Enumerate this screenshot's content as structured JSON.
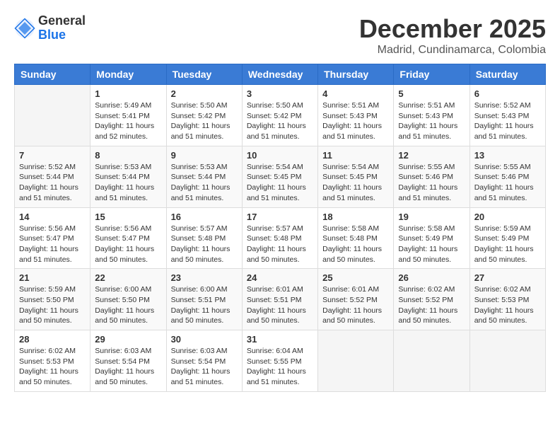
{
  "logo": {
    "general": "General",
    "blue": "Blue"
  },
  "title": "December 2025",
  "subtitle": "Madrid, Cundinamarca, Colombia",
  "weekdays": [
    "Sunday",
    "Monday",
    "Tuesday",
    "Wednesday",
    "Thursday",
    "Friday",
    "Saturday"
  ],
  "weeks": [
    [
      {
        "day": "",
        "info": ""
      },
      {
        "day": "1",
        "info": "Sunrise: 5:49 AM\nSunset: 5:41 PM\nDaylight: 11 hours\nand 52 minutes."
      },
      {
        "day": "2",
        "info": "Sunrise: 5:50 AM\nSunset: 5:42 PM\nDaylight: 11 hours\nand 51 minutes."
      },
      {
        "day": "3",
        "info": "Sunrise: 5:50 AM\nSunset: 5:42 PM\nDaylight: 11 hours\nand 51 minutes."
      },
      {
        "day": "4",
        "info": "Sunrise: 5:51 AM\nSunset: 5:43 PM\nDaylight: 11 hours\nand 51 minutes."
      },
      {
        "day": "5",
        "info": "Sunrise: 5:51 AM\nSunset: 5:43 PM\nDaylight: 11 hours\nand 51 minutes."
      },
      {
        "day": "6",
        "info": "Sunrise: 5:52 AM\nSunset: 5:43 PM\nDaylight: 11 hours\nand 51 minutes."
      }
    ],
    [
      {
        "day": "7",
        "info": "Sunrise: 5:52 AM\nSunset: 5:44 PM\nDaylight: 11 hours\nand 51 minutes."
      },
      {
        "day": "8",
        "info": "Sunrise: 5:53 AM\nSunset: 5:44 PM\nDaylight: 11 hours\nand 51 minutes."
      },
      {
        "day": "9",
        "info": "Sunrise: 5:53 AM\nSunset: 5:44 PM\nDaylight: 11 hours\nand 51 minutes."
      },
      {
        "day": "10",
        "info": "Sunrise: 5:54 AM\nSunset: 5:45 PM\nDaylight: 11 hours\nand 51 minutes."
      },
      {
        "day": "11",
        "info": "Sunrise: 5:54 AM\nSunset: 5:45 PM\nDaylight: 11 hours\nand 51 minutes."
      },
      {
        "day": "12",
        "info": "Sunrise: 5:55 AM\nSunset: 5:46 PM\nDaylight: 11 hours\nand 51 minutes."
      },
      {
        "day": "13",
        "info": "Sunrise: 5:55 AM\nSunset: 5:46 PM\nDaylight: 11 hours\nand 51 minutes."
      }
    ],
    [
      {
        "day": "14",
        "info": "Sunrise: 5:56 AM\nSunset: 5:47 PM\nDaylight: 11 hours\nand 51 minutes."
      },
      {
        "day": "15",
        "info": "Sunrise: 5:56 AM\nSunset: 5:47 PM\nDaylight: 11 hours\nand 50 minutes."
      },
      {
        "day": "16",
        "info": "Sunrise: 5:57 AM\nSunset: 5:48 PM\nDaylight: 11 hours\nand 50 minutes."
      },
      {
        "day": "17",
        "info": "Sunrise: 5:57 AM\nSunset: 5:48 PM\nDaylight: 11 hours\nand 50 minutes."
      },
      {
        "day": "18",
        "info": "Sunrise: 5:58 AM\nSunset: 5:48 PM\nDaylight: 11 hours\nand 50 minutes."
      },
      {
        "day": "19",
        "info": "Sunrise: 5:58 AM\nSunset: 5:49 PM\nDaylight: 11 hours\nand 50 minutes."
      },
      {
        "day": "20",
        "info": "Sunrise: 5:59 AM\nSunset: 5:49 PM\nDaylight: 11 hours\nand 50 minutes."
      }
    ],
    [
      {
        "day": "21",
        "info": "Sunrise: 5:59 AM\nSunset: 5:50 PM\nDaylight: 11 hours\nand 50 minutes."
      },
      {
        "day": "22",
        "info": "Sunrise: 6:00 AM\nSunset: 5:50 PM\nDaylight: 11 hours\nand 50 minutes."
      },
      {
        "day": "23",
        "info": "Sunrise: 6:00 AM\nSunset: 5:51 PM\nDaylight: 11 hours\nand 50 minutes."
      },
      {
        "day": "24",
        "info": "Sunrise: 6:01 AM\nSunset: 5:51 PM\nDaylight: 11 hours\nand 50 minutes."
      },
      {
        "day": "25",
        "info": "Sunrise: 6:01 AM\nSunset: 5:52 PM\nDaylight: 11 hours\nand 50 minutes."
      },
      {
        "day": "26",
        "info": "Sunrise: 6:02 AM\nSunset: 5:52 PM\nDaylight: 11 hours\nand 50 minutes."
      },
      {
        "day": "27",
        "info": "Sunrise: 6:02 AM\nSunset: 5:53 PM\nDaylight: 11 hours\nand 50 minutes."
      }
    ],
    [
      {
        "day": "28",
        "info": "Sunrise: 6:02 AM\nSunset: 5:53 PM\nDaylight: 11 hours\nand 50 minutes."
      },
      {
        "day": "29",
        "info": "Sunrise: 6:03 AM\nSunset: 5:54 PM\nDaylight: 11 hours\nand 50 minutes."
      },
      {
        "day": "30",
        "info": "Sunrise: 6:03 AM\nSunset: 5:54 PM\nDaylight: 11 hours\nand 51 minutes."
      },
      {
        "day": "31",
        "info": "Sunrise: 6:04 AM\nSunset: 5:55 PM\nDaylight: 11 hours\nand 51 minutes."
      },
      {
        "day": "",
        "info": ""
      },
      {
        "day": "",
        "info": ""
      },
      {
        "day": "",
        "info": ""
      }
    ]
  ]
}
